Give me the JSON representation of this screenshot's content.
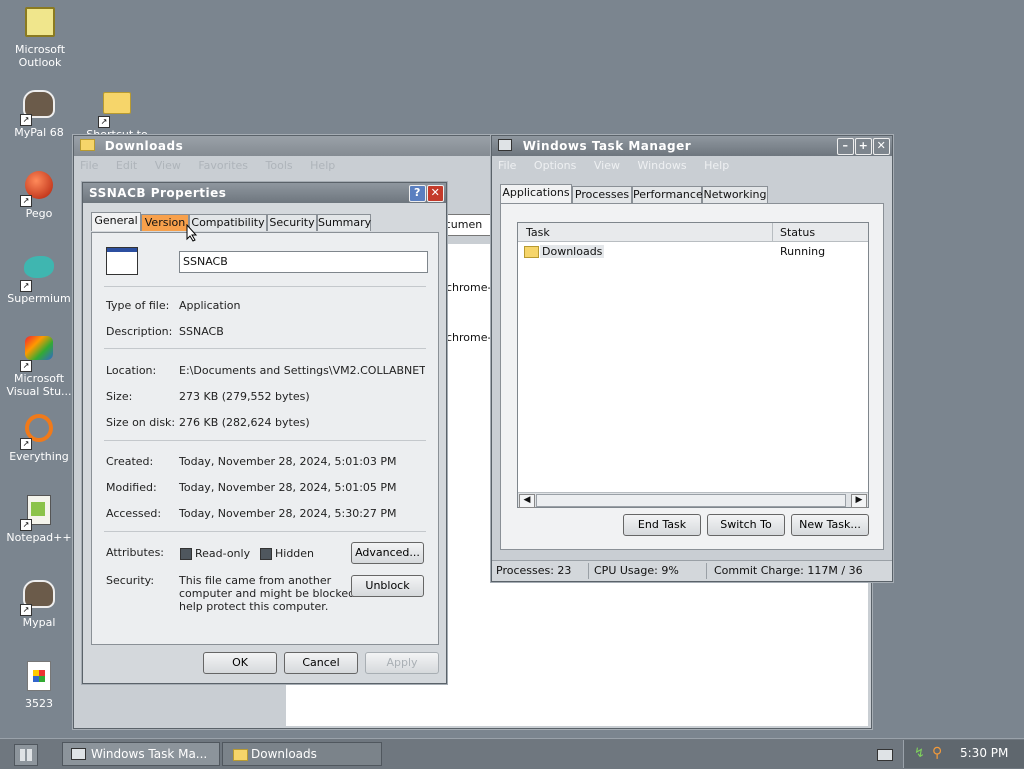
{
  "desktop": {
    "icons": [
      {
        "label": "Microsoft Outlook",
        "icon": "outlook-icon"
      },
      {
        "label": "MyPal 68",
        "icon": "mypal-icon"
      },
      {
        "label": "Shortcut to",
        "icon": "folder-icon"
      },
      {
        "label": "Pego",
        "icon": "pego-icon"
      },
      {
        "label": "Supermium",
        "icon": "supermium-icon"
      },
      {
        "label": "Microsoft Visual Stu...",
        "icon": "visual-studio-icon"
      },
      {
        "label": "Everything",
        "icon": "everything-icon"
      },
      {
        "label": "Notepad++",
        "icon": "notepadpp-icon"
      },
      {
        "label": "Mypal",
        "icon": "mypal-icon"
      },
      {
        "label": "3523",
        "icon": "document-icon"
      }
    ]
  },
  "downloads_window": {
    "title": "Downloads",
    "menu": [
      "File",
      "Edit",
      "View",
      "Favorites",
      "Tools",
      "Help"
    ],
    "address_partial": "ocumen",
    "items": [
      "chrome-",
      "chrome-"
    ]
  },
  "properties_dialog": {
    "title": "SSNACB Properties",
    "tabs": [
      "General",
      "Version",
      "Compatibility",
      "Security",
      "Summary"
    ],
    "name_value": "SSNACB",
    "fields": {
      "type_label": "Type of file:",
      "type_value": "Application",
      "desc_label": "Description:",
      "desc_value": "SSNACB",
      "location_label": "Location:",
      "location_value": "E:\\Documents and Settings\\VM2.COLLABNET\\My",
      "size_label": "Size:",
      "size_value": "273 KB (279,552 bytes)",
      "size_disk_label": "Size on disk:",
      "size_disk_value": "276 KB (282,624 bytes)",
      "created_label": "Created:",
      "created_value": "Today, November 28, 2024, 5:01:03 PM",
      "modified_label": "Modified:",
      "modified_value": "Today, November 28, 2024, 5:01:05 PM",
      "accessed_label": "Accessed:",
      "accessed_value": "Today, November 28, 2024, 5:30:27 PM",
      "attributes_label": "Attributes:",
      "readonly_label": "Read-only",
      "hidden_label": "Hidden",
      "advanced_button": "Advanced...",
      "security_label": "Security:",
      "security_text_1": "This file came from another",
      "security_text_2": "computer and might be blocked to",
      "security_text_3": "help protect this computer.",
      "unblock_button": "Unblock"
    },
    "buttons": {
      "ok": "OK",
      "cancel": "Cancel",
      "apply": "Apply"
    }
  },
  "task_manager": {
    "title": "Windows Task Manager",
    "menu": [
      "File",
      "Options",
      "View",
      "Windows",
      "Help"
    ],
    "tabs": [
      "Applications",
      "Processes",
      "Performance",
      "Networking"
    ],
    "columns": [
      "Task",
      "Status"
    ],
    "rows": [
      {
        "task": "Downloads",
        "status": "Running"
      }
    ],
    "buttons": {
      "end_task": "End Task",
      "switch_to": "Switch To",
      "new_task": "New Task..."
    },
    "status": {
      "processes": "Processes: 23",
      "cpu": "CPU Usage: 9%",
      "commit": "Commit Charge: 117M / 36"
    }
  },
  "taskbar": {
    "items": [
      "Windows Task Ma...",
      "Downloads"
    ],
    "clock": "5:30 PM"
  }
}
